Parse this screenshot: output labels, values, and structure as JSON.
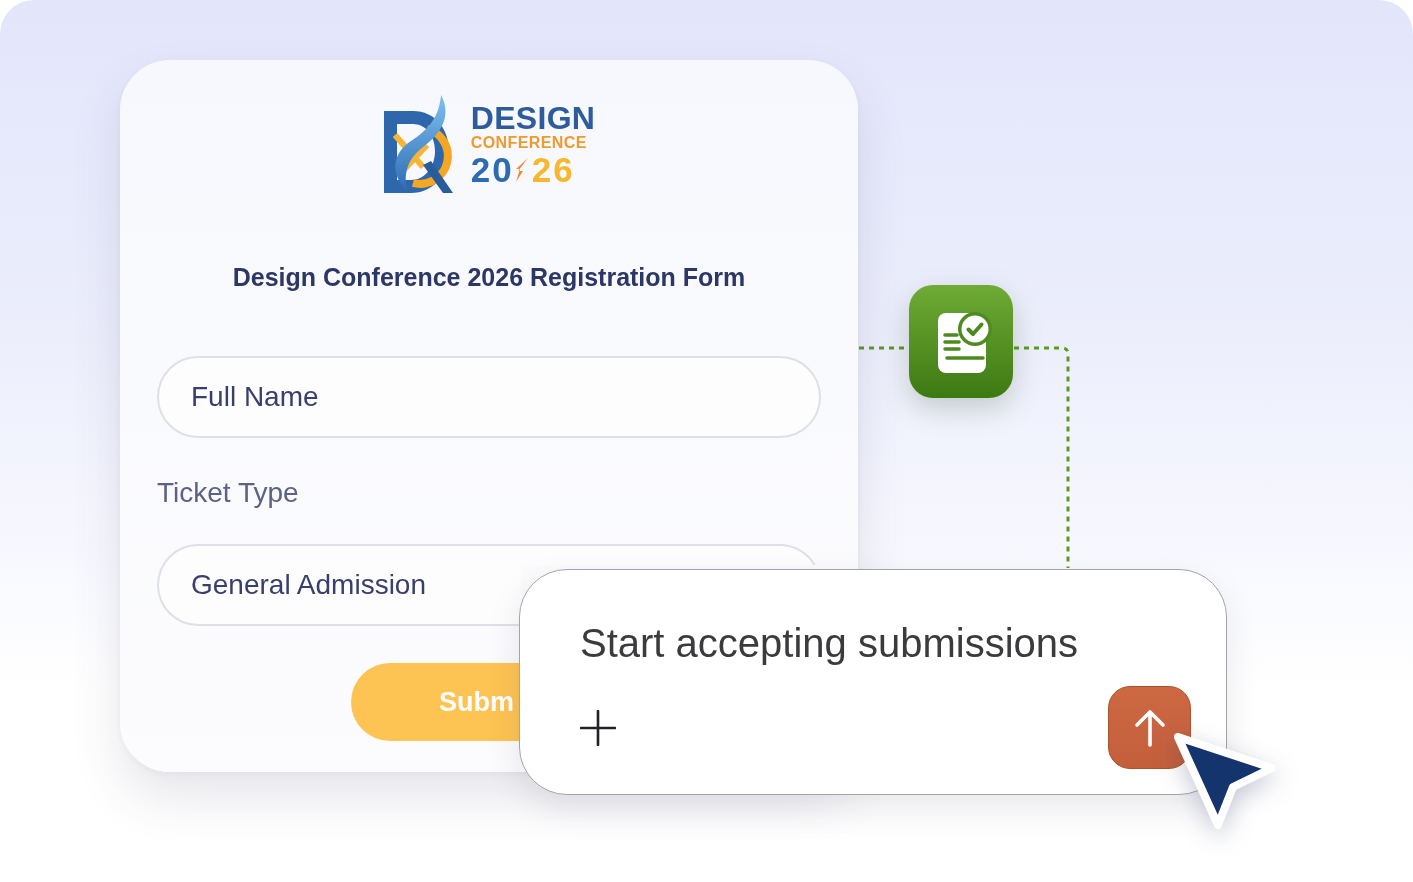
{
  "form_card": {
    "logo": {
      "name_line": "DESIGN",
      "sub_line": "CONFERENCE",
      "year_start": "20",
      "year_end": "26"
    },
    "title": "Design Conference 2026 Registration Form",
    "fields": [
      {
        "kind": "text",
        "placeholder": "Full Name"
      },
      {
        "kind": "select",
        "label": "Ticket Type",
        "value": "General Admission"
      }
    ],
    "submit_button": {
      "label": "Subm"
    }
  },
  "composer": {
    "value": "Start accepting submissions"
  }
}
